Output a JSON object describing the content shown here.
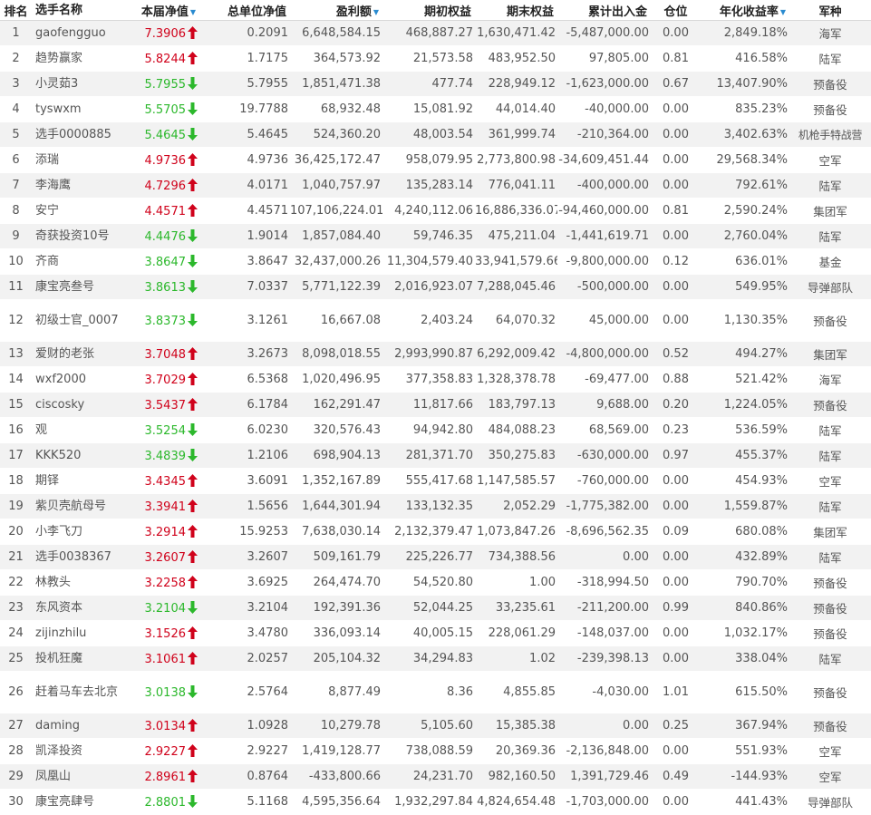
{
  "columns": {
    "rank": "排名",
    "name": "选手名称",
    "nav": "本届净值",
    "unit_nav": "总单位净值",
    "profit": "盈利额",
    "start_equity": "期初权益",
    "end_equity": "期末权益",
    "net_flow": "累计出入金",
    "position": "仓位",
    "annual_return": "年化收益率",
    "army": "军种"
  },
  "colors": {
    "up": "#d0021b",
    "down": "#2cb82c",
    "sort": "#2a8bd0",
    "stripe": "#f2f2f2"
  },
  "rows": [
    {
      "rank": "1",
      "name": "gaofengguo",
      "nav": "7.3906",
      "dir": "up",
      "unit_nav": "0.2091",
      "profit": "6,648,584.15",
      "start": "468,887.27",
      "end": "1,630,471.42",
      "flow": "-5,487,000.00",
      "pos": "0.00",
      "ann": "2,849.18%",
      "army": "海军"
    },
    {
      "rank": "2",
      "name": "趋势赢家",
      "nav": "5.8244",
      "dir": "up",
      "unit_nav": "1.7175",
      "profit": "364,573.92",
      "start": "21,573.58",
      "end": "483,952.50",
      "flow": "97,805.00",
      "pos": "0.81",
      "ann": "416.58%",
      "army": "陆军"
    },
    {
      "rank": "3",
      "name": "小灵茹3",
      "nav": "5.7955",
      "dir": "down",
      "unit_nav": "5.7955",
      "profit": "1,851,471.38",
      "start": "477.74",
      "end": "228,949.12",
      "flow": "-1,623,000.00",
      "pos": "0.67",
      "ann": "13,407.90%",
      "army": "预备役"
    },
    {
      "rank": "4",
      "name": "tyswxm",
      "nav": "5.5705",
      "dir": "down",
      "unit_nav": "19.7788",
      "profit": "68,932.48",
      "start": "15,081.92",
      "end": "44,014.40",
      "flow": "-40,000.00",
      "pos": "0.00",
      "ann": "835.23%",
      "army": "预备役"
    },
    {
      "rank": "5",
      "name": "选手0000885",
      "nav": "5.4645",
      "dir": "down",
      "unit_nav": "5.4645",
      "profit": "524,360.20",
      "start": "48,003.54",
      "end": "361,999.74",
      "flow": "-210,364.00",
      "pos": "0.00",
      "ann": "3,402.63%",
      "army": "机枪手特战营"
    },
    {
      "rank": "6",
      "name": "添瑞",
      "nav": "4.9736",
      "dir": "up",
      "unit_nav": "4.9736",
      "profit": "36,425,172.47",
      "start": "958,079.95",
      "end": "2,773,800.98",
      "flow": "-34,609,451.44",
      "pos": "0.00",
      "ann": "29,568.34%",
      "army": "空军"
    },
    {
      "rank": "7",
      "name": "李海鹰",
      "nav": "4.7296",
      "dir": "up",
      "unit_nav": "4.0171",
      "profit": "1,040,757.97",
      "start": "135,283.14",
      "end": "776,041.11",
      "flow": "-400,000.00",
      "pos": "0.00",
      "ann": "792.61%",
      "army": "陆军"
    },
    {
      "rank": "8",
      "name": "安宁",
      "nav": "4.4571",
      "dir": "up",
      "unit_nav": "4.4571",
      "profit": "107,106,224.01",
      "start": "4,240,112.06",
      "end": "16,886,336.07",
      "flow": "-94,460,000.00",
      "pos": "0.81",
      "ann": "2,590.24%",
      "army": "集团军"
    },
    {
      "rank": "9",
      "name": "奇获投资10号",
      "nav": "4.4476",
      "dir": "down",
      "unit_nav": "1.9014",
      "profit": "1,857,084.40",
      "start": "59,746.35",
      "end": "475,211.04",
      "flow": "-1,441,619.71",
      "pos": "0.00",
      "ann": "2,760.04%",
      "army": "陆军"
    },
    {
      "rank": "10",
      "name": "齐商",
      "nav": "3.8647",
      "dir": "down",
      "unit_nav": "3.8647",
      "profit": "32,437,000.26",
      "start": "11,304,579.40",
      "end": "33,941,579.66",
      "flow": "-9,800,000.00",
      "pos": "0.12",
      "ann": "636.01%",
      "army": "基金"
    },
    {
      "rank": "11",
      "name": "康宝亮叁号",
      "nav": "3.8613",
      "dir": "down",
      "unit_nav": "7.0337",
      "profit": "5,771,122.39",
      "start": "2,016,923.07",
      "end": "7,288,045.46",
      "flow": "-500,000.00",
      "pos": "0.00",
      "ann": "549.95%",
      "army": "导弹部队"
    },
    {
      "rank": "12",
      "name": "初级士官_0007",
      "nav": "3.8373",
      "dir": "down",
      "unit_nav": "3.1261",
      "profit": "16,667.08",
      "start": "2,403.24",
      "end": "64,070.32",
      "flow": "45,000.00",
      "pos": "0.00",
      "ann": "1,130.35%",
      "army": "预备役",
      "tall": true
    },
    {
      "rank": "13",
      "name": "爱财的老张",
      "nav": "3.7048",
      "dir": "up",
      "unit_nav": "3.2673",
      "profit": "8,098,018.55",
      "start": "2,993,990.87",
      "end": "6,292,009.42",
      "flow": "-4,800,000.00",
      "pos": "0.52",
      "ann": "494.27%",
      "army": "集团军"
    },
    {
      "rank": "14",
      "name": "wxf2000",
      "nav": "3.7029",
      "dir": "up",
      "unit_nav": "6.5368",
      "profit": "1,020,496.95",
      "start": "377,358.83",
      "end": "1,328,378.78",
      "flow": "-69,477.00",
      "pos": "0.88",
      "ann": "521.42%",
      "army": "海军"
    },
    {
      "rank": "15",
      "name": "ciscosky",
      "nav": "3.5437",
      "dir": "up",
      "unit_nav": "6.1784",
      "profit": "162,291.47",
      "start": "11,817.66",
      "end": "183,797.13",
      "flow": "9,688.00",
      "pos": "0.20",
      "ann": "1,224.05%",
      "army": "预备役"
    },
    {
      "rank": "16",
      "name": "观",
      "nav": "3.5254",
      "dir": "down",
      "unit_nav": "6.0230",
      "profit": "320,576.43",
      "start": "94,942.80",
      "end": "484,088.23",
      "flow": "68,569.00",
      "pos": "0.23",
      "ann": "536.59%",
      "army": "陆军"
    },
    {
      "rank": "17",
      "name": "KKK520",
      "nav": "3.4839",
      "dir": "down",
      "unit_nav": "1.2106",
      "profit": "698,904.13",
      "start": "281,371.70",
      "end": "350,275.83",
      "flow": "-630,000.00",
      "pos": "0.97",
      "ann": "455.37%",
      "army": "陆军"
    },
    {
      "rank": "18",
      "name": "期铎",
      "nav": "3.4345",
      "dir": "up",
      "unit_nav": "3.6091",
      "profit": "1,352,167.89",
      "start": "555,417.68",
      "end": "1,147,585.57",
      "flow": "-760,000.00",
      "pos": "0.00",
      "ann": "454.93%",
      "army": "空军"
    },
    {
      "rank": "19",
      "name": "紫贝壳航母号",
      "nav": "3.3941",
      "dir": "up",
      "unit_nav": "1.5656",
      "profit": "1,644,301.94",
      "start": "133,132.35",
      "end": "2,052.29",
      "flow": "-1,775,382.00",
      "pos": "0.00",
      "ann": "1,559.87%",
      "army": "陆军"
    },
    {
      "rank": "20",
      "name": "小李飞刀",
      "nav": "3.2914",
      "dir": "up",
      "unit_nav": "15.9253",
      "profit": "7,638,030.14",
      "start": "2,132,379.47",
      "end": "1,073,847.26",
      "flow": "-8,696,562.35",
      "pos": "0.09",
      "ann": "680.08%",
      "army": "集团军"
    },
    {
      "rank": "21",
      "name": "选手0038367",
      "nav": "3.2607",
      "dir": "up",
      "unit_nav": "3.2607",
      "profit": "509,161.79",
      "start": "225,226.77",
      "end": "734,388.56",
      "flow": "0.00",
      "pos": "0.00",
      "ann": "432.89%",
      "army": "陆军"
    },
    {
      "rank": "22",
      "name": "林教头",
      "nav": "3.2258",
      "dir": "up",
      "unit_nav": "3.6925",
      "profit": "264,474.70",
      "start": "54,520.80",
      "end": "1.00",
      "flow": "-318,994.50",
      "pos": "0.00",
      "ann": "790.70%",
      "army": "预备役"
    },
    {
      "rank": "23",
      "name": "东风资本",
      "nav": "3.2104",
      "dir": "down",
      "unit_nav": "3.2104",
      "profit": "192,391.36",
      "start": "52,044.25",
      "end": "33,235.61",
      "flow": "-211,200.00",
      "pos": "0.99",
      "ann": "840.86%",
      "army": "预备役"
    },
    {
      "rank": "24",
      "name": "zijinzhilu",
      "nav": "3.1526",
      "dir": "up",
      "unit_nav": "3.4780",
      "profit": "336,093.14",
      "start": "40,005.15",
      "end": "228,061.29",
      "flow": "-148,037.00",
      "pos": "0.00",
      "ann": "1,032.17%",
      "army": "预备役"
    },
    {
      "rank": "25",
      "name": "投机狂魔",
      "nav": "3.1061",
      "dir": "up",
      "unit_nav": "2.0257",
      "profit": "205,104.32",
      "start": "34,294.83",
      "end": "1.02",
      "flow": "-239,398.13",
      "pos": "0.00",
      "ann": "338.04%",
      "army": "陆军"
    },
    {
      "rank": "26",
      "name": "赶着马车去北京",
      "nav": "3.0138",
      "dir": "down",
      "unit_nav": "2.5764",
      "profit": "8,877.49",
      "start": "8.36",
      "end": "4,855.85",
      "flow": "-4,030.00",
      "pos": "1.01",
      "ann": "615.50%",
      "army": "预备役",
      "tall": true
    },
    {
      "rank": "27",
      "name": "daming",
      "nav": "3.0134",
      "dir": "up",
      "unit_nav": "1.0928",
      "profit": "10,279.78",
      "start": "5,105.60",
      "end": "15,385.38",
      "flow": "0.00",
      "pos": "0.25",
      "ann": "367.94%",
      "army": "预备役"
    },
    {
      "rank": "28",
      "name": "凯泽投资",
      "nav": "2.9227",
      "dir": "up",
      "unit_nav": "2.9227",
      "profit": "1,419,128.77",
      "start": "738,088.59",
      "end": "20,369.36",
      "flow": "-2,136,848.00",
      "pos": "0.00",
      "ann": "551.93%",
      "army": "空军"
    },
    {
      "rank": "29",
      "name": "凤凰山",
      "nav": "2.8961",
      "dir": "up",
      "unit_nav": "0.8764",
      "profit": "-433,800.66",
      "start": "24,231.70",
      "end": "982,160.50",
      "flow": "1,391,729.46",
      "pos": "0.49",
      "ann": "-144.93%",
      "army": "空军"
    },
    {
      "rank": "30",
      "name": "康宝亮肆号",
      "nav": "2.8801",
      "dir": "down",
      "unit_nav": "5.1168",
      "profit": "4,595,356.64",
      "start": "1,932,297.84",
      "end": "4,824,654.48",
      "flow": "-1,703,000.00",
      "pos": "0.00",
      "ann": "441.43%",
      "army": "导弹部队"
    }
  ]
}
